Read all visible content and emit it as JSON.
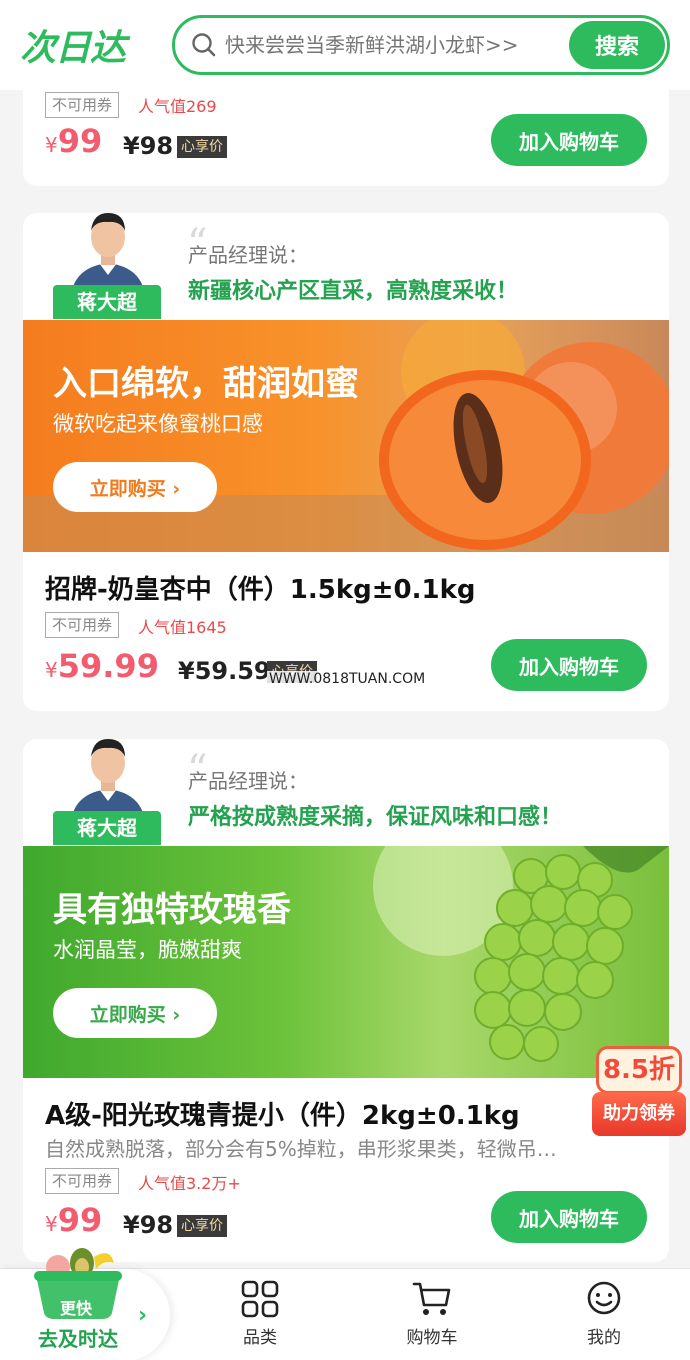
{
  "header": {
    "logo": "次日达",
    "search_placeholder": "快来尝尝当季新鲜洪湖小龙虾>>",
    "search_button": "搜索"
  },
  "colors": {
    "brand_green": "#2dbb5e",
    "price_pink": "#f25c6e",
    "popularity_red": "#e84a4a"
  },
  "products": [
    {
      "coupon": "不可用券",
      "popularity": "人气值269",
      "price_symbol": "¥",
      "price": "99",
      "vip_price": "¥98",
      "vip_tag": "心享价",
      "add_cart": "加入购物车"
    },
    {
      "pm_name": "蒋大超",
      "pm_label": "产品经理说：",
      "pm_quote": "新疆核心产区直采，高熟度采收！",
      "banner_title": "入口绵软，甜润如蜜",
      "banner_sub": "微软吃起来像蜜桃口感",
      "buy_now": "立即购买 ›",
      "title": "招牌-奶皇杏中（件）1.5kg±0.1kg",
      "coupon": "不可用券",
      "popularity": "人气值1645",
      "price_symbol": "¥",
      "price": "59.99",
      "vip_price": "¥59.59",
      "vip_tag": "心享价",
      "add_cart": "加入购物车"
    },
    {
      "pm_name": "蒋大超",
      "pm_label": "产品经理说：",
      "pm_quote": "严格按成熟度采摘，保证风味和口感！",
      "banner_title": "具有独特玫瑰香",
      "banner_sub": "水润晶莹，脆嫩甜爽",
      "buy_now": "立即购买 ›",
      "title": "A级-阳光玫瑰青提小（件）2kg±0.1kg",
      "desc": "自然成熟脱落，部分会有5%掉粒，串形浆果类，轻微吊…",
      "coupon": "不可用券",
      "popularity": "人气值3.2万+",
      "price_symbol": "¥",
      "price": "99",
      "vip_price": "¥98",
      "vip_tag": "心享价",
      "add_cart": "加入购物车"
    }
  ],
  "watermark": "WWW.0818TUAN.COM",
  "discount_badge": {
    "value": "8.5折",
    "label": "助力领券"
  },
  "bottom_nav": {
    "quick_top": "更快",
    "quick_label": "去及时达",
    "items": [
      {
        "label": "品类",
        "icon": "grid-icon"
      },
      {
        "label": "购物车",
        "icon": "cart-icon"
      },
      {
        "label": "我的",
        "icon": "smiley-icon"
      }
    ]
  }
}
